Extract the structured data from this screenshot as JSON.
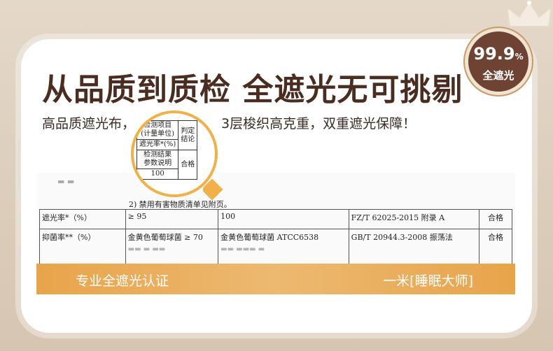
{
  "headline": "从品质到质检 全遮光无可挑剔",
  "subline": {
    "left": "高品质遮光布，",
    "right": "3层梭织高克重，双重遮光保障！"
  },
  "badge": {
    "value": "99.9",
    "unit": "%",
    "label": "全遮光"
  },
  "magnifier": {
    "item_header": "检测项目",
    "item_unit": "(计量单位)",
    "verdict_header": "判定",
    "verdict_header2": "结论",
    "item_name": "遮光率*(%)",
    "result_header": "检测结果",
    "result_header2": "参数说明",
    "result_value": "100",
    "verdict": "合格"
  },
  "report": {
    "note": "2) 禁用有害物质清单见附页。",
    "rows": [
      {
        "item": "遮光率*（%）",
        "requirement": "≥ 95",
        "result": "100",
        "standard": "FZ/T 62025-2015 附录 A",
        "verdict": "合格"
      },
      {
        "item": "抑菌率**（%）",
        "requirement": "金黄色葡萄球菌 ≥ 70",
        "result": "金黄色葡萄球菌 ATCC6538",
        "standard": "GB/T 20944.3-2008 振荡法",
        "verdict": "合格"
      }
    ]
  },
  "banner": {
    "left": "专业全遮光认证",
    "right": "一米[睡眠大师]"
  }
}
